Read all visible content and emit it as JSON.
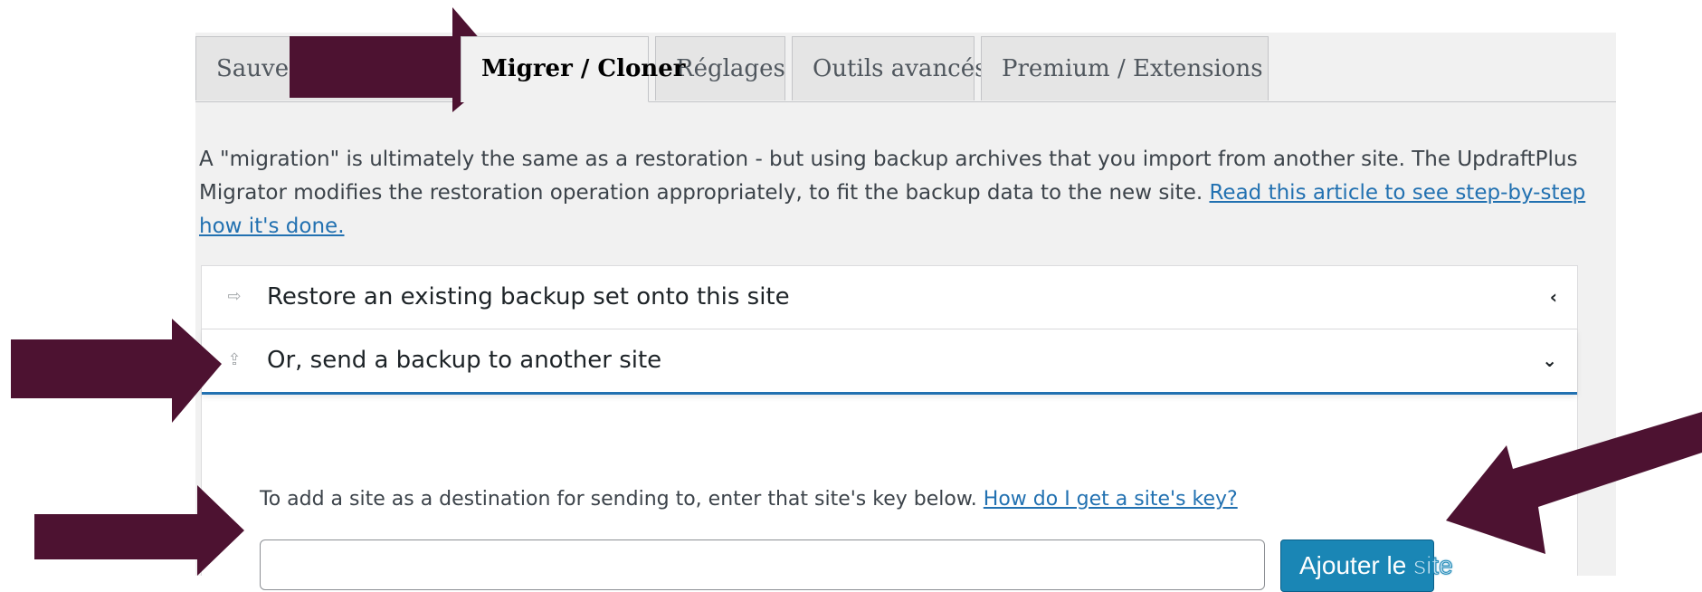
{
  "tabs": [
    {
      "label": "Sauvegarder / Restaurer",
      "active": false
    },
    {
      "label": "Migrer / Cloner",
      "active": true
    },
    {
      "label": "Réglages",
      "active": false
    },
    {
      "label": "Outils avancés",
      "active": false
    },
    {
      "label": "Premium / Extensions",
      "active": false
    }
  ],
  "intro": {
    "text": "A \"migration\" is ultimately the same as a restoration - but using backup archives that you import from another site. The UpdraftPlus Migrator modifies the restoration operation appropriately, to fit the backup data to the new site. ",
    "link_text": "Read this article to see step-by-step how it's done."
  },
  "accordion": {
    "restore": {
      "label": "Restore an existing backup set onto this site",
      "icon": "restore-icon",
      "chevron": "‹"
    },
    "send": {
      "label": "Or, send a backup to another site",
      "icon": "upload-icon",
      "chevron": "⌄"
    }
  },
  "send_panel": {
    "instruction": "To add a site as a destination for sending to, enter that site's key below. ",
    "help_link": "How do I get a site's key?",
    "key_input_value": "",
    "add_button_label": "Ajouter le",
    "add_button_overflow": "site"
  },
  "colors": {
    "arrow": "#4d1231",
    "accent": "#2271b1",
    "button": "#1a86b5"
  }
}
